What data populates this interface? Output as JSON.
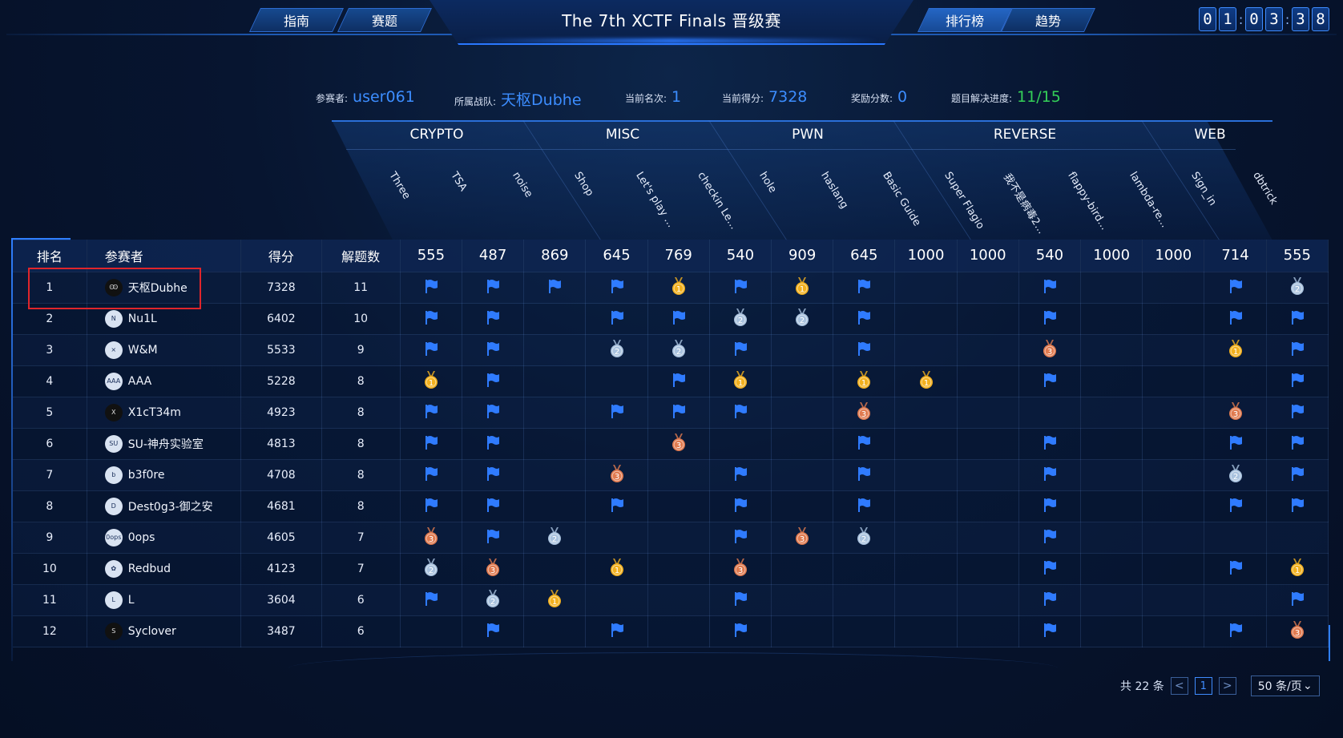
{
  "header": {
    "title": "The 7th XCTF Finals 晋级赛",
    "nav_left": [
      "指南",
      "赛题"
    ],
    "nav_right": [
      "排行榜",
      "趋势"
    ],
    "active_nav": "排行榜",
    "timer_digits": [
      "0",
      "1",
      "0",
      "3",
      "3",
      "8"
    ]
  },
  "info": {
    "participant_label": "参赛者:",
    "participant": "user061",
    "team_label": "所属战队:",
    "team": "天枢Dubhe",
    "rank_label": "当前名次:",
    "rank": "1",
    "score_label": "当前得分:",
    "score": "7328",
    "bonus_label": "奖励分数:",
    "bonus": "0",
    "progress_label": "题目解决进度:",
    "progress": "11/15"
  },
  "categories": [
    {
      "name": "CRYPTO",
      "count": 3
    },
    {
      "name": "MISC",
      "count": 3
    },
    {
      "name": "PWN",
      "count": 3
    },
    {
      "name": "REVERSE",
      "count": 4
    },
    {
      "name": "WEB",
      "count": 2
    }
  ],
  "challenges": [
    {
      "name": "Three",
      "points": "555"
    },
    {
      "name": "TSA",
      "points": "487"
    },
    {
      "name": "noise",
      "points": "869"
    },
    {
      "name": "Shop",
      "points": "645"
    },
    {
      "name": "Let's play ...",
      "points": "769"
    },
    {
      "name": "checkin Le...",
      "points": "540"
    },
    {
      "name": "hole",
      "points": "909"
    },
    {
      "name": "haslang",
      "points": "645"
    },
    {
      "name": "Basic Guide",
      "points": "1000"
    },
    {
      "name": "Super Flagio",
      "points": "1000"
    },
    {
      "name": "我不是病毒2...",
      "points": "540"
    },
    {
      "name": "flappy-bird...",
      "points": "1000"
    },
    {
      "name": "lambda-re...",
      "points": "1000"
    },
    {
      "name": "Sign_in",
      "points": "714"
    },
    {
      "name": "dbtrick",
      "points": "555"
    }
  ],
  "table_headers": {
    "rank": "排名",
    "team": "参赛者",
    "score": "得分",
    "solved": "解题数"
  },
  "rows": [
    {
      "rank": "1",
      "team": "天枢Dubhe",
      "avatar": "Ꙭ",
      "dark": true,
      "score": "7328",
      "solved": "11",
      "cells": [
        "F",
        "F",
        "F",
        "F",
        "G",
        "F",
        "G",
        "F",
        "",
        "",
        "F",
        "",
        "",
        "F",
        "S"
      ]
    },
    {
      "rank": "2",
      "team": "Nu1L",
      "avatar": "N",
      "dark": false,
      "score": "6402",
      "solved": "10",
      "cells": [
        "F",
        "F",
        "",
        "F",
        "F",
        "S",
        "S",
        "F",
        "",
        "",
        "F",
        "",
        "",
        "F",
        "F"
      ]
    },
    {
      "rank": "3",
      "team": "W&M",
      "avatar": "⨯",
      "dark": false,
      "score": "5533",
      "solved": "9",
      "cells": [
        "F",
        "F",
        "",
        "S",
        "S",
        "F",
        "",
        "F",
        "",
        "",
        "B",
        "",
        "",
        "G",
        "F"
      ]
    },
    {
      "rank": "4",
      "team": "AAA",
      "avatar": "AAA",
      "dark": false,
      "score": "5228",
      "solved": "8",
      "cells": [
        "G",
        "F",
        "",
        "",
        "F",
        "G",
        "",
        "G",
        "G",
        "",
        "F",
        "",
        "",
        "",
        "F"
      ]
    },
    {
      "rank": "5",
      "team": "X1cT34m",
      "avatar": "X",
      "dark": true,
      "score": "4923",
      "solved": "8",
      "cells": [
        "F",
        "F",
        "",
        "F",
        "F",
        "F",
        "",
        "B",
        "",
        "",
        "",
        "",
        "",
        "B",
        "F"
      ]
    },
    {
      "rank": "6",
      "team": "SU-神舟实验室",
      "avatar": "SU",
      "dark": false,
      "score": "4813",
      "solved": "8",
      "cells": [
        "F",
        "F",
        "",
        "",
        "B",
        "",
        "",
        "F",
        "",
        "",
        "F",
        "",
        "",
        "F",
        "F"
      ]
    },
    {
      "rank": "7",
      "team": "b3f0re",
      "avatar": "b",
      "dark": false,
      "score": "4708",
      "solved": "8",
      "cells": [
        "F",
        "F",
        "",
        "B",
        "",
        "F",
        "",
        "F",
        "",
        "",
        "F",
        "",
        "",
        "S",
        "F"
      ]
    },
    {
      "rank": "8",
      "team": "Dest0g3-御之安",
      "avatar": "D",
      "dark": false,
      "score": "4681",
      "solved": "8",
      "cells": [
        "F",
        "F",
        "",
        "F",
        "",
        "F",
        "",
        "F",
        "",
        "",
        "F",
        "",
        "",
        "F",
        "F"
      ]
    },
    {
      "rank": "9",
      "team": "0ops",
      "avatar": "0ops",
      "dark": false,
      "score": "4605",
      "solved": "7",
      "cells": [
        "B",
        "F",
        "S",
        "",
        "",
        "F",
        "B",
        "S",
        "",
        "",
        "F",
        "",
        "",
        "",
        ""
      ]
    },
    {
      "rank": "10",
      "team": "Redbud",
      "avatar": "✿",
      "dark": false,
      "score": "4123",
      "solved": "7",
      "cells": [
        "S",
        "B",
        "",
        "G",
        "",
        "B",
        "",
        "",
        "",
        "",
        "F",
        "",
        "",
        "F",
        "G"
      ]
    },
    {
      "rank": "11",
      "team": "L",
      "avatar": "L",
      "dark": false,
      "score": "3604",
      "solved": "6",
      "cells": [
        "F",
        "S",
        "G",
        "",
        "",
        "F",
        "",
        "",
        "",
        "",
        "F",
        "",
        "",
        "",
        "F"
      ]
    },
    {
      "rank": "12",
      "team": "Syclover",
      "avatar": "S",
      "dark": true,
      "score": "3487",
      "solved": "6",
      "cells": [
        "",
        "F",
        "",
        "F",
        "",
        "F",
        "",
        "",
        "",
        "",
        "F",
        "",
        "",
        "F",
        "B"
      ]
    }
  ],
  "medal_numbers": {
    "G": "1",
    "S": "2",
    "B": "3"
  },
  "colors": {
    "flag": "#2f7bff",
    "gold": "#f2b01e",
    "silver": "#a9c2de",
    "bronze": "#e07a4f",
    "accent": "#3c8dff",
    "progress": "#34d058",
    "highlight": "#e0252b"
  },
  "pager": {
    "total": "共 22 条",
    "prev": "<",
    "page": "1",
    "next": ">",
    "page_size": "50 条/页"
  }
}
